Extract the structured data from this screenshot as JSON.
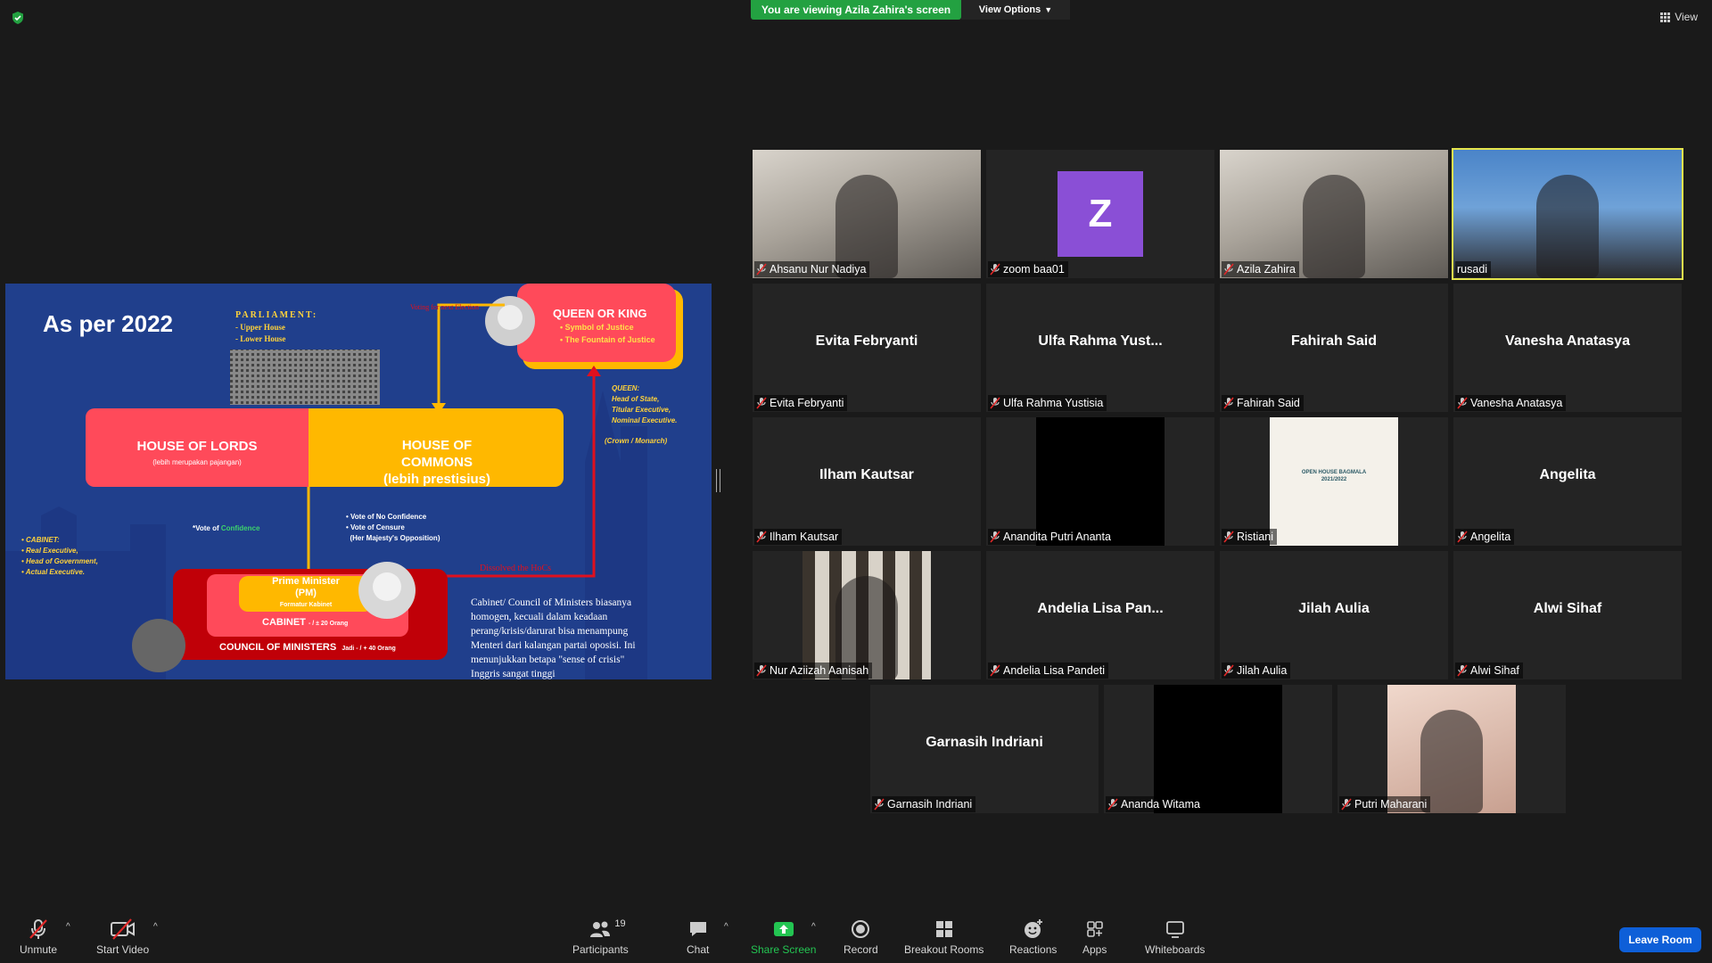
{
  "top": {
    "banner": "You are viewing Azila Zahira's screen",
    "view_options": "View Options",
    "view": "View"
  },
  "slide": {
    "title": "As per 2022",
    "parliament_heading": "PARLIAMENT:",
    "parliament_items": [
      "- Upper House",
      "- Lower House"
    ],
    "queen_note_red": "Voting for next Election",
    "queen_title": "QUEEN OR KING",
    "queen_items": [
      "Symbol of Justice",
      "The Fountain of Justice"
    ],
    "queen_list": [
      "QUEEN:",
      "Head of State,",
      "Titular Executive,",
      "Nominal Executive."
    ],
    "crown": "(Crown / Monarch)",
    "lords_title": "HOUSE OF LORDS",
    "lords_sub": "(lebih merupakan pajangan)",
    "commons_title_1": "HOUSE OF",
    "commons_title_2": "COMMONS",
    "commons_sub": "(lebih prestisius)",
    "vote_conf_pre": "*Vote of ",
    "vote_conf_word": "Confidence",
    "vote_items": [
      "Vote of No Confidence",
      "Vote of Censure",
      "(Her Majesty's Opposition)"
    ],
    "cabinet_list": [
      "CABINET:",
      "Real Executive,",
      "Head of Government,",
      "Actual Executive."
    ],
    "dissolved": "Dissolved the HoCs",
    "pm_title": "Prime Minister",
    "pm_sub": "(PM)",
    "pm_note": "Formatur Kabinet",
    "cabinet_label": "CABINET",
    "cabinet_count": "- / ± 20 Orang",
    "council_label": "COUNCIL OF MINISTERS",
    "council_count": "Jadi - / + 40 Orang",
    "text_lines": [
      "Cabinet/ Council of Ministers biasanya",
      "homogen, kecuali dalam keadaan",
      "perang/krisis/darurat bisa menampung",
      "Menteri dari kalangan partai oposisi. Ini",
      "menunjukkan betapa \"sense of crisis\"",
      "Inggris sangat tinggi"
    ]
  },
  "participants": [
    {
      "name": "Ahsanu Nur Nadiya",
      "big": "",
      "type": "video"
    },
    {
      "name": "zoom baa01",
      "big": "",
      "type": "avatar",
      "initial": "Z"
    },
    {
      "name": "Azila Zahira",
      "big": "",
      "type": "video"
    },
    {
      "name": "rusadi",
      "big": "",
      "type": "video",
      "active": true
    },
    {
      "name": "Evita Febryanti",
      "big": "Evita Febryanti",
      "type": "name"
    },
    {
      "name": "Ulfa Rahma Yustisia",
      "big": "Ulfa Rahma Yust...",
      "type": "name"
    },
    {
      "name": "Fahirah Said",
      "big": "Fahirah Said",
      "type": "name"
    },
    {
      "name": "Vanesha Anatasya",
      "big": "Vanesha Anatasya",
      "type": "name"
    },
    {
      "name": "Ilham Kautsar",
      "big": "Ilham Kautsar",
      "type": "name"
    },
    {
      "name": "Anandita Putri Ananta",
      "big": "",
      "type": "black"
    },
    {
      "name": "Ristiani",
      "big": "",
      "type": "poster",
      "poster_text": "OPEN HOUSE BAGMALA 2021/2022"
    },
    {
      "name": "Angelita",
      "big": "Angelita",
      "type": "name"
    },
    {
      "name": "Nur Aziizah Aanisah",
      "big": "",
      "type": "video"
    },
    {
      "name": "Andelia Lisa Pandeti",
      "big": "Andelia Lisa Pan...",
      "type": "name"
    },
    {
      "name": "Jilah Aulia",
      "big": "Jilah Aulia",
      "type": "name"
    },
    {
      "name": "Alwi Sihaf",
      "big": "Alwi Sihaf",
      "type": "name"
    },
    {
      "name": "Garnasih Indriani",
      "big": "Garnasih Indriani",
      "type": "name"
    },
    {
      "name": "Ananda Witama",
      "big": "",
      "type": "black"
    },
    {
      "name": "Putri Maharani",
      "big": "",
      "type": "video"
    }
  ],
  "toolbar": {
    "unmute": "Unmute",
    "start_video": "Start Video",
    "participants": "Participants",
    "participants_count": "19",
    "chat": "Chat",
    "share_screen": "Share Screen",
    "record": "Record",
    "breakout_rooms": "Breakout Rooms",
    "reactions": "Reactions",
    "apps": "Apps",
    "whiteboards": "Whiteboards",
    "leave_room": "Leave Room"
  },
  "colors": {
    "share_green": "#23a141",
    "active_speaker": "#e5e54d",
    "leave_blue": "#0e5fd8",
    "slide_blue": "#203f8c"
  }
}
